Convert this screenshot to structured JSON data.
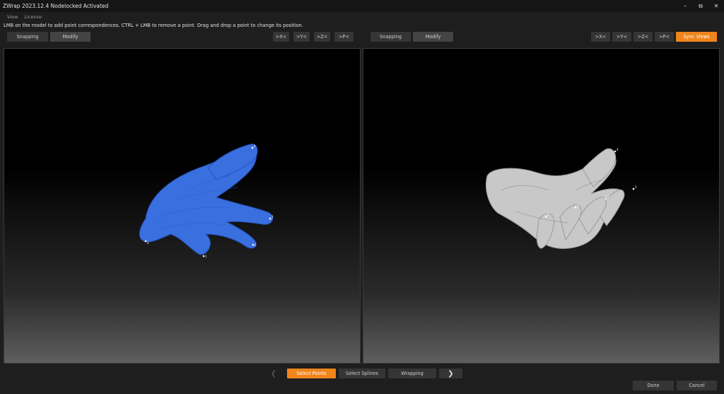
{
  "window": {
    "title": "ZWrap 2023.12.4  Nodelocked Activated",
    "minimize_glyph": "–",
    "restore_glyph": "⧉",
    "close_glyph": "✕"
  },
  "menu": {
    "items": [
      "View",
      "License"
    ]
  },
  "hint": "LMB on the model to add point correspondences. CTRL + LMB to remove a point. Drag and drop a point to change its position.",
  "left_toolbar": {
    "snapping": "Snapping",
    "modify": "Modify",
    "axis_buttons": [
      ">X<",
      ">Y<",
      ">Z<",
      ">P<"
    ]
  },
  "right_toolbar": {
    "snapping": "Snapping",
    "modify": "Modify",
    "axis_buttons": [
      ">X<",
      ">Y<",
      ">Z<",
      ">P<"
    ],
    "sync_views": "Sync Views"
  },
  "left_viewport": {
    "model_color": "#3a6fe0",
    "point_labels": [
      "0",
      "1",
      "2",
      "3",
      "4"
    ]
  },
  "right_viewport": {
    "model_color": "#c8c8c8",
    "point_labels": [
      "4",
      "3",
      "2",
      "1",
      "0"
    ]
  },
  "steps": {
    "prev_glyph": "❮",
    "next_glyph": "❯",
    "select_points": "Select Points",
    "select_splines": "Select Splines",
    "wrapping": "Wrapping"
  },
  "footer": {
    "done": "Done",
    "cancel": "Cancel"
  },
  "colors": {
    "accent": "#f0851c",
    "background": "#1e1e1e"
  }
}
